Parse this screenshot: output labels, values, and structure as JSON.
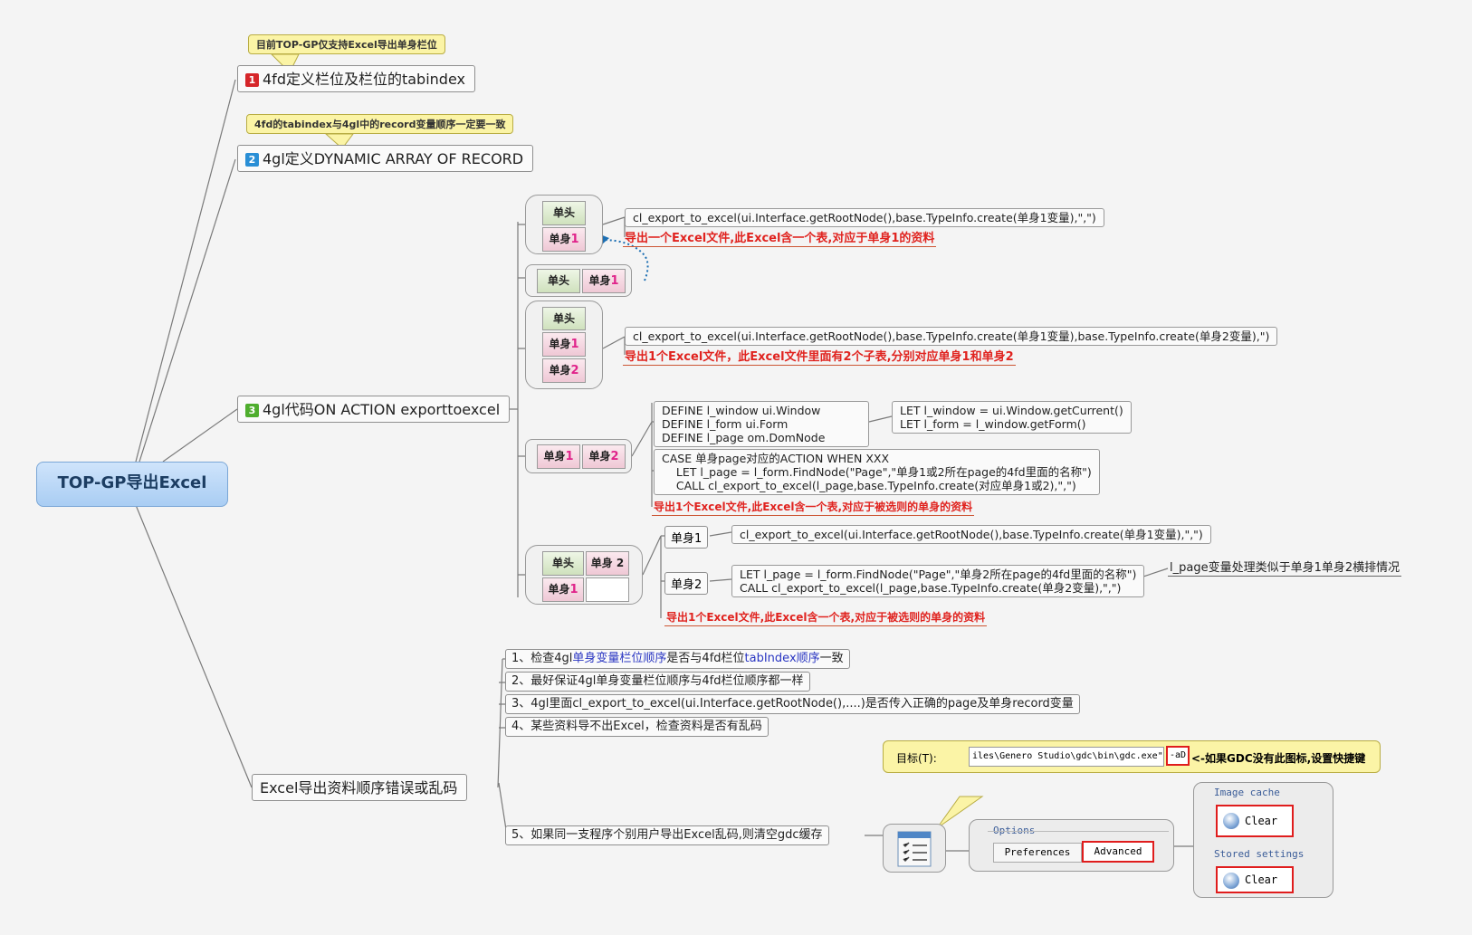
{
  "central": "TOP-GP导出Excel",
  "branch1": {
    "badge": "1",
    "label": "4fd定义栏位及栏位的tabindex",
    "callout": "目前TOP-GP仅支持Excel导出单身栏位"
  },
  "branch2": {
    "badge": "2",
    "label": "4gl定义DYNAMIC ARRAY OF RECORD",
    "callout": "4fd的tabindex与4gl中的record变量顺序一定要一致"
  },
  "branch3": {
    "badge": "3",
    "label": "4gl代码ON ACTION exporttoexcel",
    "grid_labels": {
      "head": "单头",
      "body": "单身",
      "one": "1",
      "two": "2",
      "body2": "单身 2"
    },
    "case1": {
      "code": "cl_export_to_excel(ui.Interface.getRootNode(),base.TypeInfo.create(单身1变量),\",\")",
      "result": "导出一个Excel文件,此Excel含一个表,对应于单身1的资料"
    },
    "case3": {
      "code": "cl_export_to_excel(ui.Interface.getRootNode(),base.TypeInfo.create(单身1变量),base.TypeInfo.create(单身2变量),\")",
      "result": "导出1个Excel文件，此Excel文件里面有2个子表,分别对应单身1和单身2"
    },
    "case4": {
      "define": [
        "DEFINE  l_window       ui.Window",
        "DEFINE  l_form          ui.Form",
        "DEFINE  l_page          om.DomNode"
      ],
      "let": [
        "LET l_window = ui.Window.getCurrent()",
        "LET l_form    = l_window.getForm()"
      ],
      "case_code": [
        "CASE 单身page对应的ACTION    WHEN XXX",
        "    LET l_page = l_form.FindNode(\"Page\",\"单身1或2所在page的4fd里面的名称\")",
        "    CALL cl_export_to_excel(l_page,base.TypeInfo.create(对应单身1或2),\",\")"
      ],
      "result": "导出1个Excel文件,此Excel含一个表,对应于被选则的单身的资料"
    },
    "case5": {
      "body1_label": "单身1",
      "body1_code": "cl_export_to_excel(ui.Interface.getRootNode(),base.TypeInfo.create(单身1变量),\",\")",
      "body2_label": "单身2",
      "body2_code": [
        "LET l_page = l_form.FindNode(\"Page\",\"单身2所在page的4fd里面的名称\")",
        "CALL cl_export_to_excel(l_page,base.TypeInfo.create(单身2变量),\",\")"
      ],
      "note": "l_page变量处理类似于单身1单身2横排情况",
      "result": "导出1个Excel文件,此Excel含一个表,对应于被选则的单身的资料"
    }
  },
  "branch4": {
    "label": "Excel导出资料顺序错误或乱码",
    "steps": [
      {
        "a": "1、检查4gl",
        "b": "单身变量栏位顺序",
        "c": "是否与4fd栏位",
        "d": "tabIndex顺序",
        "e": "一致"
      },
      {
        "a": "2、最好保证4gl单身变量栏位顺序与4fd栏位顺序都一样"
      },
      {
        "a": "3、4gl里面cl_export_to_excel(ui.Interface.getRootNode(),....)是否传入正确的page及单身record变量"
      },
      {
        "a": "4、某些资料导不出Excel，检查资料是否有乱码"
      },
      {
        "a": "5、如果同一支程序个别用户导出Excel乱码,则清空gdc缓存"
      }
    ],
    "shortcut": {
      "field_label": "目标(T):",
      "path": "iles\\Genero Studio\\gdc\\bin\\gdc.exe\"",
      "flag": "-aD",
      "hint": "<-如果GDC没有此图标,设置快捷键"
    },
    "options": {
      "title": "Options",
      "tab1": "Preferences",
      "tab2": "Advanced"
    },
    "cache": {
      "image_title": "Image cache",
      "stored_title": "Stored settings",
      "clear": "Clear"
    }
  },
  "colors": {
    "red": "#e0231f",
    "central_fill": "#a9cdf3",
    "callout": "#fbf4a6",
    "blue_link": "#2a36c2"
  }
}
